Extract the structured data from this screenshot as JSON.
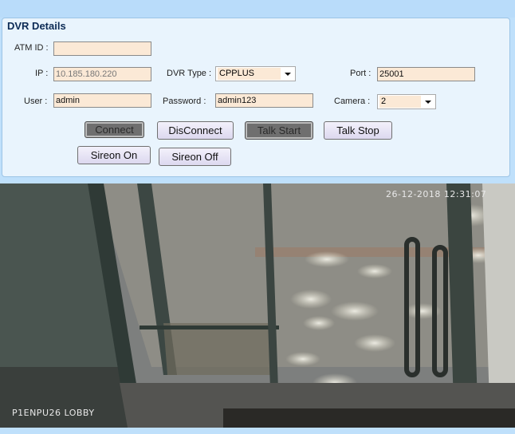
{
  "panel": {
    "title": "DVR Details"
  },
  "form": {
    "atm_id": {
      "label": "ATM ID :",
      "value": ""
    },
    "ip": {
      "label": "IP :",
      "value": "10.185.180.220"
    },
    "dvr_type": {
      "label": "DVR Type :",
      "value": "CPPLUS"
    },
    "port": {
      "label": "Port :",
      "value": "25001"
    },
    "user": {
      "label": "User :",
      "value": "admin"
    },
    "password": {
      "label": "Password :",
      "value": "admin123"
    },
    "camera": {
      "label": "Camera :",
      "value": "2"
    }
  },
  "buttons": {
    "connect": "Connect",
    "disconnect": "DisConnect",
    "talk_start": "Talk Start",
    "talk_stop": "Talk Stop",
    "sireon_on": "Sireon On",
    "sireon_off": "Sireon Off"
  },
  "camera_feed": {
    "timestamp": "26-12-2018 12:31:07",
    "camera_name": "P1ENPU26 LOBBY"
  },
  "colors": {
    "background": "#bfe0fb",
    "panel": "#e9f4fd",
    "field": "#fbe9d6",
    "pressed_button": "#6f6f6f"
  }
}
